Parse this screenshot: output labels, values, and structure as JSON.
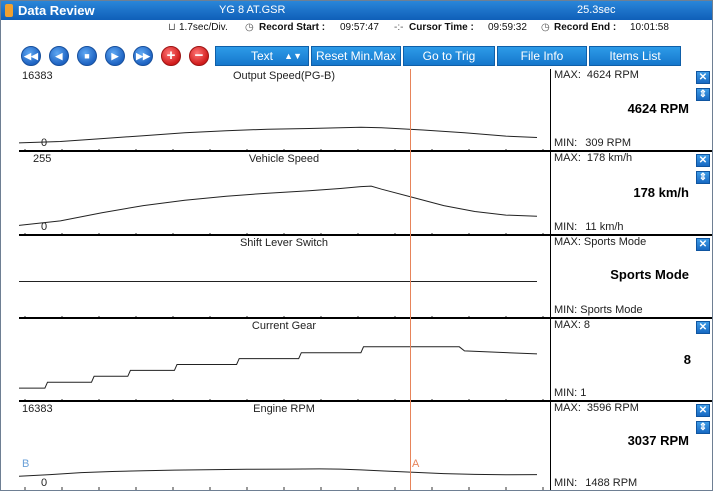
{
  "window": {
    "title": "Data Review",
    "file": "YG 8 AT.GSR",
    "duration": "25.3sec"
  },
  "info": {
    "scale": "1.7sec/Div.",
    "record_start_label": "Record Start :",
    "record_start_value": "09:57:47",
    "cursor_time_label": "Cursor Time :",
    "cursor_time_value": "09:59:32",
    "record_end_label": "Record End :",
    "record_end_value": "10:01:58"
  },
  "toolbar": {
    "playback": [
      "first-icon",
      "previous-icon",
      "stop-icon",
      "play-icon",
      "last-icon"
    ],
    "zoom_in_label": "+",
    "zoom_out_label": "−",
    "text_label": "Text",
    "reset_label": "Reset Min.Max",
    "trig_label": "Go to Trig",
    "fileinfo_label": "File Info",
    "items_label": "Items List"
  },
  "markers": {
    "a": "A",
    "b": "B"
  },
  "channels": [
    {
      "name": "Output Speed(PG-B)",
      "ymax_label": "16383",
      "ymin_label": "0",
      "ymin": 0,
      "ymax": 16383,
      "max_label": "MAX:",
      "max_value": "4624 RPM",
      "current": "4624 RPM",
      "min_label": "MIN:",
      "min_value": "309 RPM",
      "data": [
        [
          0,
          309
        ],
        [
          8,
          700
        ],
        [
          16,
          1500
        ],
        [
          24,
          2300
        ],
        [
          32,
          3100
        ],
        [
          40,
          3700
        ],
        [
          48,
          4100
        ],
        [
          56,
          4300
        ],
        [
          62,
          4500
        ],
        [
          66,
          4624
        ],
        [
          70,
          4500
        ],
        [
          78,
          3900
        ],
        [
          86,
          3100
        ],
        [
          94,
          2200
        ],
        [
          100,
          1800
        ]
      ]
    },
    {
      "name": "Vehicle Speed",
      "ymax_label": "255",
      "ymin_label": "0",
      "ymin": 0,
      "ymax": 255,
      "max_label": "MAX:",
      "max_value": "178 km/h",
      "current": "178 km/h",
      "min_label": "MIN:",
      "min_value": "11 km/h",
      "data": [
        [
          0,
          11
        ],
        [
          8,
          30
        ],
        [
          16,
          65
        ],
        [
          24,
          95
        ],
        [
          32,
          118
        ],
        [
          40,
          135
        ],
        [
          48,
          148
        ],
        [
          56,
          158
        ],
        [
          62,
          168
        ],
        [
          66,
          176
        ],
        [
          68,
          178
        ],
        [
          70,
          165
        ],
        [
          76,
          130
        ],
        [
          82,
          95
        ],
        [
          88,
          70
        ],
        [
          94,
          55
        ],
        [
          100,
          50
        ]
      ]
    },
    {
      "name": "Shift Lever Switch",
      "ymax_label": "",
      "ymin_label": "",
      "ymin": 0,
      "ymax": 2,
      "max_label": "MAX:",
      "max_value": "Sports Mode",
      "current": "Sports Mode",
      "min_label": "MIN:",
      "min_value": "Sports Mode",
      "data": [
        [
          0,
          1
        ],
        [
          100,
          1
        ]
      ]
    },
    {
      "name": "Current Gear",
      "ymax_label": "",
      "ymin_label": "",
      "ymin": 0,
      "ymax": 10,
      "max_label": "MAX:",
      "max_value": "8",
      "current": "8",
      "min_label": "MIN:",
      "min_value": "1",
      "data": [
        [
          0,
          1
        ],
        [
          5,
          1
        ],
        [
          5.5,
          2
        ],
        [
          14,
          2
        ],
        [
          14.5,
          3
        ],
        [
          21,
          3
        ],
        [
          21.5,
          4
        ],
        [
          30,
          4
        ],
        [
          30.5,
          5
        ],
        [
          42,
          5
        ],
        [
          42.5,
          6
        ],
        [
          54,
          6
        ],
        [
          54.5,
          7
        ],
        [
          66,
          7
        ],
        [
          66.5,
          8
        ],
        [
          85,
          8
        ],
        [
          86,
          7.3
        ],
        [
          100,
          6.8
        ]
      ]
    },
    {
      "name": "Engine RPM",
      "ymax_label": "16383",
      "ymin_label": "0",
      "ymin": 0,
      "ymax": 16383,
      "max_label": "MAX:",
      "max_value": "3596 RPM",
      "current": "3037 RPM",
      "min_label": "MIN:",
      "min_value": "1488 RPM",
      "data": [
        [
          0,
          1488
        ],
        [
          6,
          1900
        ],
        [
          12,
          2400
        ],
        [
          18,
          2700
        ],
        [
          24,
          2900
        ],
        [
          30,
          3050
        ],
        [
          36,
          3150
        ],
        [
          44,
          3250
        ],
        [
          52,
          3300
        ],
        [
          58,
          3350
        ],
        [
          62,
          3300
        ],
        [
          66,
          3100
        ],
        [
          70,
          2850
        ],
        [
          76,
          2500
        ],
        [
          82,
          2150
        ],
        [
          88,
          1950
        ],
        [
          94,
          1850
        ],
        [
          100,
          1900
        ]
      ]
    }
  ]
}
